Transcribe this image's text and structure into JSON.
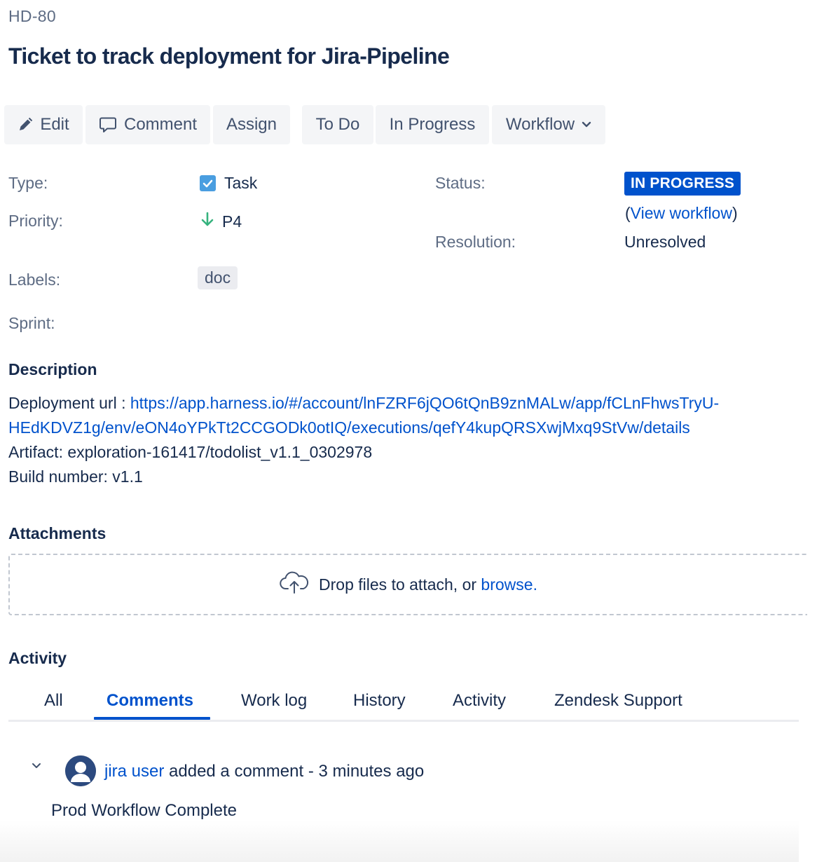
{
  "issue": {
    "key": "HD-80",
    "title": "Ticket to track deployment for Jira-Pipeline"
  },
  "toolbar": {
    "edit_label": "Edit",
    "comment_label": "Comment",
    "assign_label": "Assign",
    "todo_label": "To Do",
    "inprogress_label": "In Progress",
    "workflow_label": "Workflow"
  },
  "details": {
    "type_label": "Type:",
    "type_value": "Task",
    "priority_label": "Priority:",
    "priority_value": "P4",
    "labels_label": "Labels:",
    "label_tag": "doc",
    "sprint_label": "Sprint:",
    "status_label": "Status:",
    "status_value": "IN PROGRESS",
    "view_workflow_open": "(",
    "view_workflow_link": "View workflow",
    "view_workflow_close": ")",
    "resolution_label": "Resolution:",
    "resolution_value": "Unresolved"
  },
  "description": {
    "heading": "Description",
    "url_prefix": "Deployment url : ",
    "url_line1": "https://app.harness.io/#/account/lnFZRF6jQO6tQnB9znMALw/app/fCLnFhwsTryU-",
    "url_line2": "HEdKDVZ1g/env/eON4oYPkTt2CCGODk0otIQ/executions/qefY4kupQRSXwjMxq9StVw/details",
    "artifact": "Artifact: exploration-161417/todolist_v1.1_0302978",
    "build": "Build number: v1.1"
  },
  "attachments": {
    "heading": "Attachments",
    "drop_text": "Drop files to attach, or ",
    "browse_link": "browse."
  },
  "activity": {
    "heading": "Activity",
    "tabs": [
      "All",
      "Comments",
      "Work log",
      "History",
      "Activity",
      "Zendesk Support"
    ],
    "active_tab": "Comments"
  },
  "comment": {
    "author": "jira user",
    "action": " added a comment - 3 minutes ago",
    "body": "Prod Workflow Complete"
  },
  "colors": {
    "primary": "#0052cc",
    "text": "#172b4d",
    "muted": "#5e6c84",
    "button_bg": "#f4f5f7",
    "priority_arrow": "#36b37e"
  },
  "icons": {
    "edit": "pencil-icon",
    "comment": "speech-bubble-icon",
    "workflow": "chevron-down-icon",
    "type": "checkbox-icon",
    "priority": "arrow-down-icon",
    "upload": "cloud-upload-icon",
    "collapse": "chevron-down-icon",
    "avatar": "user-avatar-icon"
  }
}
